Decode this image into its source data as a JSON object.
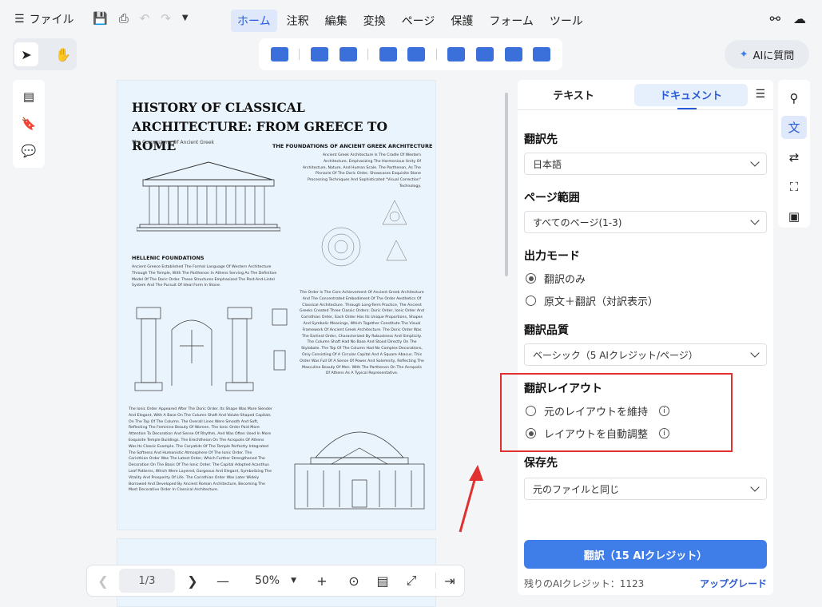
{
  "toolbar": {
    "file_label": "ファイル",
    "menu": [
      "ホーム",
      "注釈",
      "編集",
      "変換",
      "ページ",
      "保護",
      "フォーム",
      "ツール"
    ],
    "active_menu_index": 0,
    "ai_label": "AIに質問"
  },
  "document": {
    "title": "HISTORY OF CLASSICAL  ARCHITECTURE: FROM GREECE TO ROME",
    "subtitle": "The Cornerstone Of Ancient Greek",
    "h_foundations": "THE FOUNDATIONS OF ANCIENT GREEK ARCHITECTURE",
    "p_foundations": "Ancient Greek Architecture Is The Cradle Of Western Architecture, Emphasizing The Harmonious Unity Of Architecture, Nature, And Human Scale. The Parthenon, As The Pinnacle Of The Doric Order, Showcases Exquisite Stone Processing Techniques And Sophisticated \"Visual Correction\" Technology.",
    "h_hellenic": "HELLENIC FOUNDATIONS",
    "p_hellenic": "Ancient Greece Established The Formal Language Of Western Architecture Through The Temple, With The Parthenon In Athens Serving As The Definitive Model Of The Doric Order. These Structures Emphasized The Post-And-Lintel System And The Pursuit Of Ideal Form In Stone.",
    "p_order": "The Order Is The Core Achievement Of Ancient Greek Architecture And The Concentrated Embodiment Of The Order Aesthetics Of Classical Architecture. Through Long-Term Practice, The Ancient Greeks Created Three Classic Orders: Doric Order, Ionic Order And Corinthian Order, Each Order Has Its Unique Proportions, Shapes And Symbolic Meanings, Which Together Constitute The Visual Framework Of Ancient Greek Architecture. The Doric Order Was The Earliest Order, Characterized By Robustness And Simplicity. The Column Shaft Had No Base And Stood Directly On The Stylobate. The Top Of The Column Had No Complex Decorations, Only Consisting Of A Circular Capital And A Square Abacus. This Order Was Full Of A Sense Of Power And Solemnity, Reflecting The Masculine Beauty Of Men. With The Parthenon On The Acropolis Of Athens As A Typical Representative.",
    "p_ionic": "The Ionic Order Appeared After The Doric Order. Its Shape Was More Slender And Elegant, With A Base On The Column Shaft And Volute-Shaped Capitals On The Top Of The Column. The Overall Lines Were Smooth And Soft, Reflecting The Feminine Beauty Of Women. The Ionic Order Paid More Attention To Decoration And Sense Of Rhythm, And Was Often Used In More Exquisite Temple Buildings. The Erechtheion On The Acropolis Of Athens Was Its Classic Example. The Caryatids Of The Temple Perfectly Integrated The Softness And Humanistic Atmosphere Of The Ionic Order. The Corinthian Order Was The Latest Order, Which Further Strengthened The Decoration On The Basis Of The Ionic Order. The Capital Adopted Acanthus Leaf Patterns, Which Were Layered, Gorgeous And Elegant, Symbolizing The Vitality And Prosperity Of Life. The Corinthian Order Was Later Widely Borrowed And Developed By Ancient Roman Architecture, Becoming The Most Decorative Order In Classical Architecture."
  },
  "pager": {
    "page": "1/3",
    "zoom": "50%"
  },
  "panel": {
    "tab_text": "テキスト",
    "tab_document": "ドキュメント",
    "target_label": "翻訳先",
    "target_value": "日本語",
    "range_label": "ページ範囲",
    "range_value": "すべてのページ(1-3)",
    "mode_label": "出力モード",
    "mode_opt1": "翻訳のみ",
    "mode_opt2": "原文＋翻訳（対訳表示）",
    "quality_label": "翻訳品質",
    "quality_value": "ベーシック（5 AIクレジット/ページ）",
    "layout_label": "翻訳レイアウト",
    "layout_opt1": "元のレイアウトを維持",
    "layout_opt2": "レイアウトを自動調整",
    "save_label": "保存先",
    "save_value": "元のファイルと同じ",
    "translate_btn": "翻訳（15 AIクレジット）",
    "credits": "残りのAIクレジット：1123",
    "upgrade": "アップグレード"
  },
  "colors": {
    "accent": "#3f7ee8",
    "highlight": "#e0302f",
    "page_bg": "#eaf4fc"
  }
}
